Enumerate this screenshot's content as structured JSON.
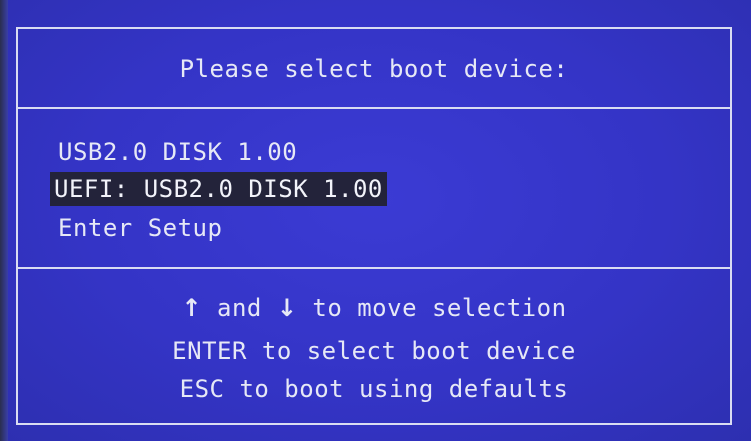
{
  "dialog": {
    "title": "Please select boot device:"
  },
  "boot_options": [
    {
      "label": "USB2.0 DISK 1.00",
      "selected": false
    },
    {
      "label": "UEFI: USB2.0 DISK 1.00",
      "selected": true
    },
    {
      "label": "Enter Setup",
      "selected": false
    }
  ],
  "help": {
    "line1": {
      "up_arrow": "↑",
      "and": " and ",
      "down_arrow": "↓",
      "rest": " to move selection"
    },
    "line2": "ENTER to select boot device",
    "line3": "ESC to boot using defaults"
  },
  "colors": {
    "background": "#3434c6",
    "text": "#e6e8f6",
    "selection_bg": "#23233a"
  }
}
